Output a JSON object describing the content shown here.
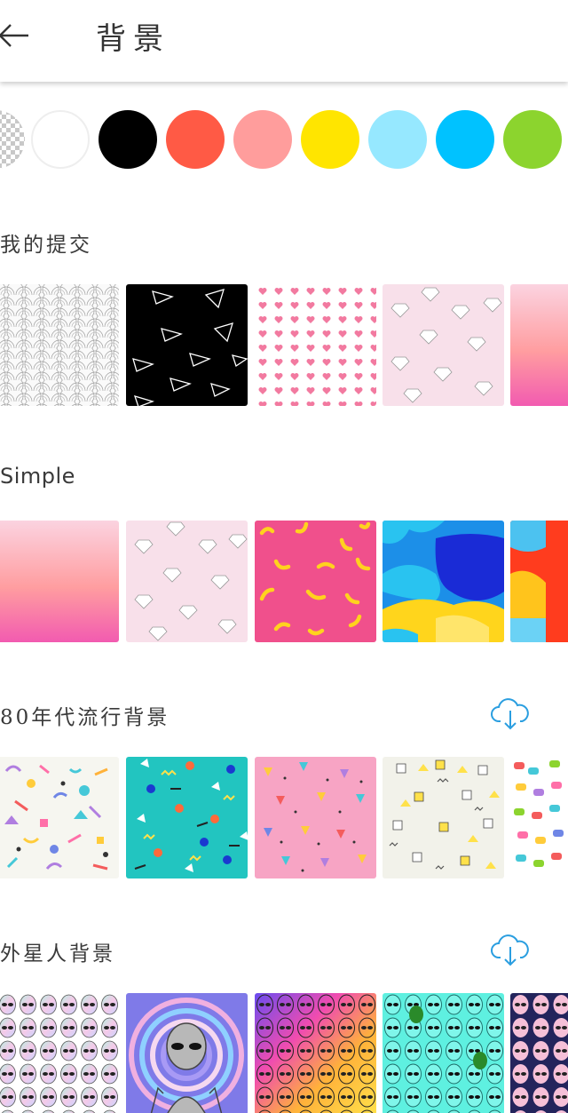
{
  "header": {
    "title": "背景",
    "back_icon": "arrow-left-icon"
  },
  "swatches": [
    {
      "name": "transparent",
      "color": "checker"
    },
    {
      "name": "white",
      "color": "#ffffff"
    },
    {
      "name": "black",
      "color": "#000000"
    },
    {
      "name": "coral",
      "color": "#ff5a45"
    },
    {
      "name": "pink",
      "color": "#ff9d9c"
    },
    {
      "name": "yellow",
      "color": "#ffe500"
    },
    {
      "name": "light-blue",
      "color": "#96e8ff"
    },
    {
      "name": "sky-blue",
      "color": "#00c2ff"
    },
    {
      "name": "green",
      "color": "#8cd42e"
    }
  ],
  "sections": [
    {
      "title": "我的提交",
      "download_icon": false,
      "tiles": [
        "wave-scales-pattern",
        "paper-planes-pattern",
        "pink-hearts-pattern",
        "diamonds-pattern",
        "pink-gradient"
      ]
    },
    {
      "title": "Simple",
      "download_icon": false,
      "tiles": [
        "pink-gradient",
        "diamonds-pattern",
        "bananas-pattern",
        "paint-strokes-blue",
        "paint-strokes-red"
      ]
    },
    {
      "title": "80年代流行背景",
      "download_icon": true,
      "tiles": [
        "memphis-white-pattern",
        "memphis-teal-pattern",
        "memphis-pink-pattern",
        "memphis-cubes-pattern",
        "memphis-candy-pattern"
      ]
    },
    {
      "title": "外星人背景",
      "download_icon": true,
      "tiles": [
        "aliens-holo-pattern",
        "alien-psychedelic",
        "aliens-rainbow-pattern",
        "aliens-cyan-pattern",
        "aliens-navy-pattern"
      ]
    }
  ],
  "colors": {
    "accent": "#2a9ee0",
    "divider": "#e6e6e6"
  }
}
